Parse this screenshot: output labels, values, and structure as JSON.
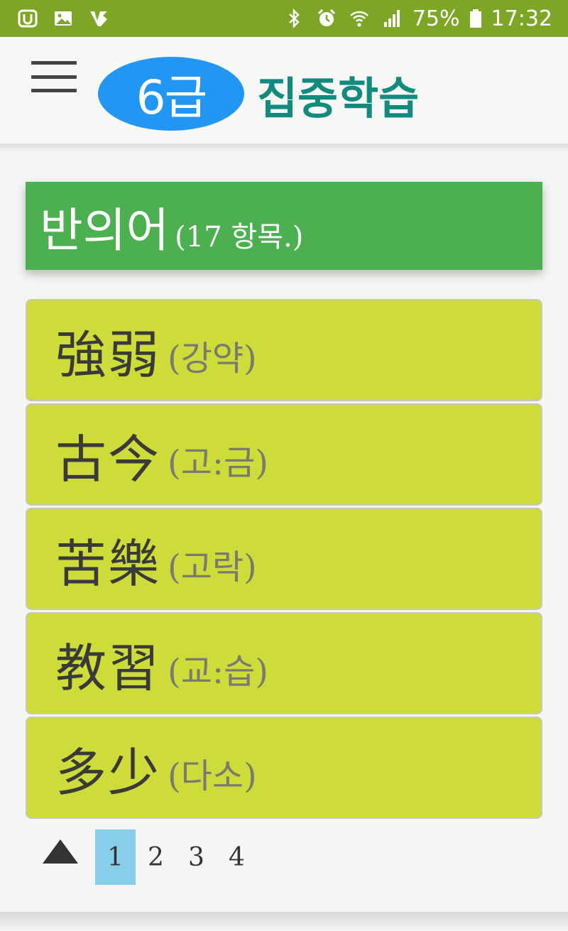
{
  "status_bar": {
    "battery": "75%",
    "time": "17:32",
    "left_icons": [
      "u-plus-icon",
      "image-icon",
      "v3-icon"
    ],
    "right_icons": [
      "bluetooth-icon",
      "alarm-icon",
      "wifi-icon",
      "signal-icon",
      "battery-icon"
    ]
  },
  "app_bar": {
    "grade": "6급",
    "title": "집중학습"
  },
  "category": {
    "title": "반의어",
    "count": "(17 항목.)"
  },
  "words": [
    {
      "hanja": "強弱",
      "reading": "(강약)"
    },
    {
      "hanja": "古今",
      "reading": "(고:금)"
    },
    {
      "hanja": "苦樂",
      "reading": "(고락)"
    },
    {
      "hanja": "教習",
      "reading": "(교:습)"
    },
    {
      "hanja": "多少",
      "reading": "(다소)"
    }
  ],
  "pager": {
    "pages": [
      "1",
      "2",
      "3",
      "4"
    ],
    "current": "1"
  },
  "colors": {
    "status_bar": "#7ea626",
    "grade_badge": "#2196f3",
    "title": "#128b7e",
    "category_header": "#4caf50",
    "word_item": "#cddc39",
    "active_page": "#87ceeb"
  }
}
